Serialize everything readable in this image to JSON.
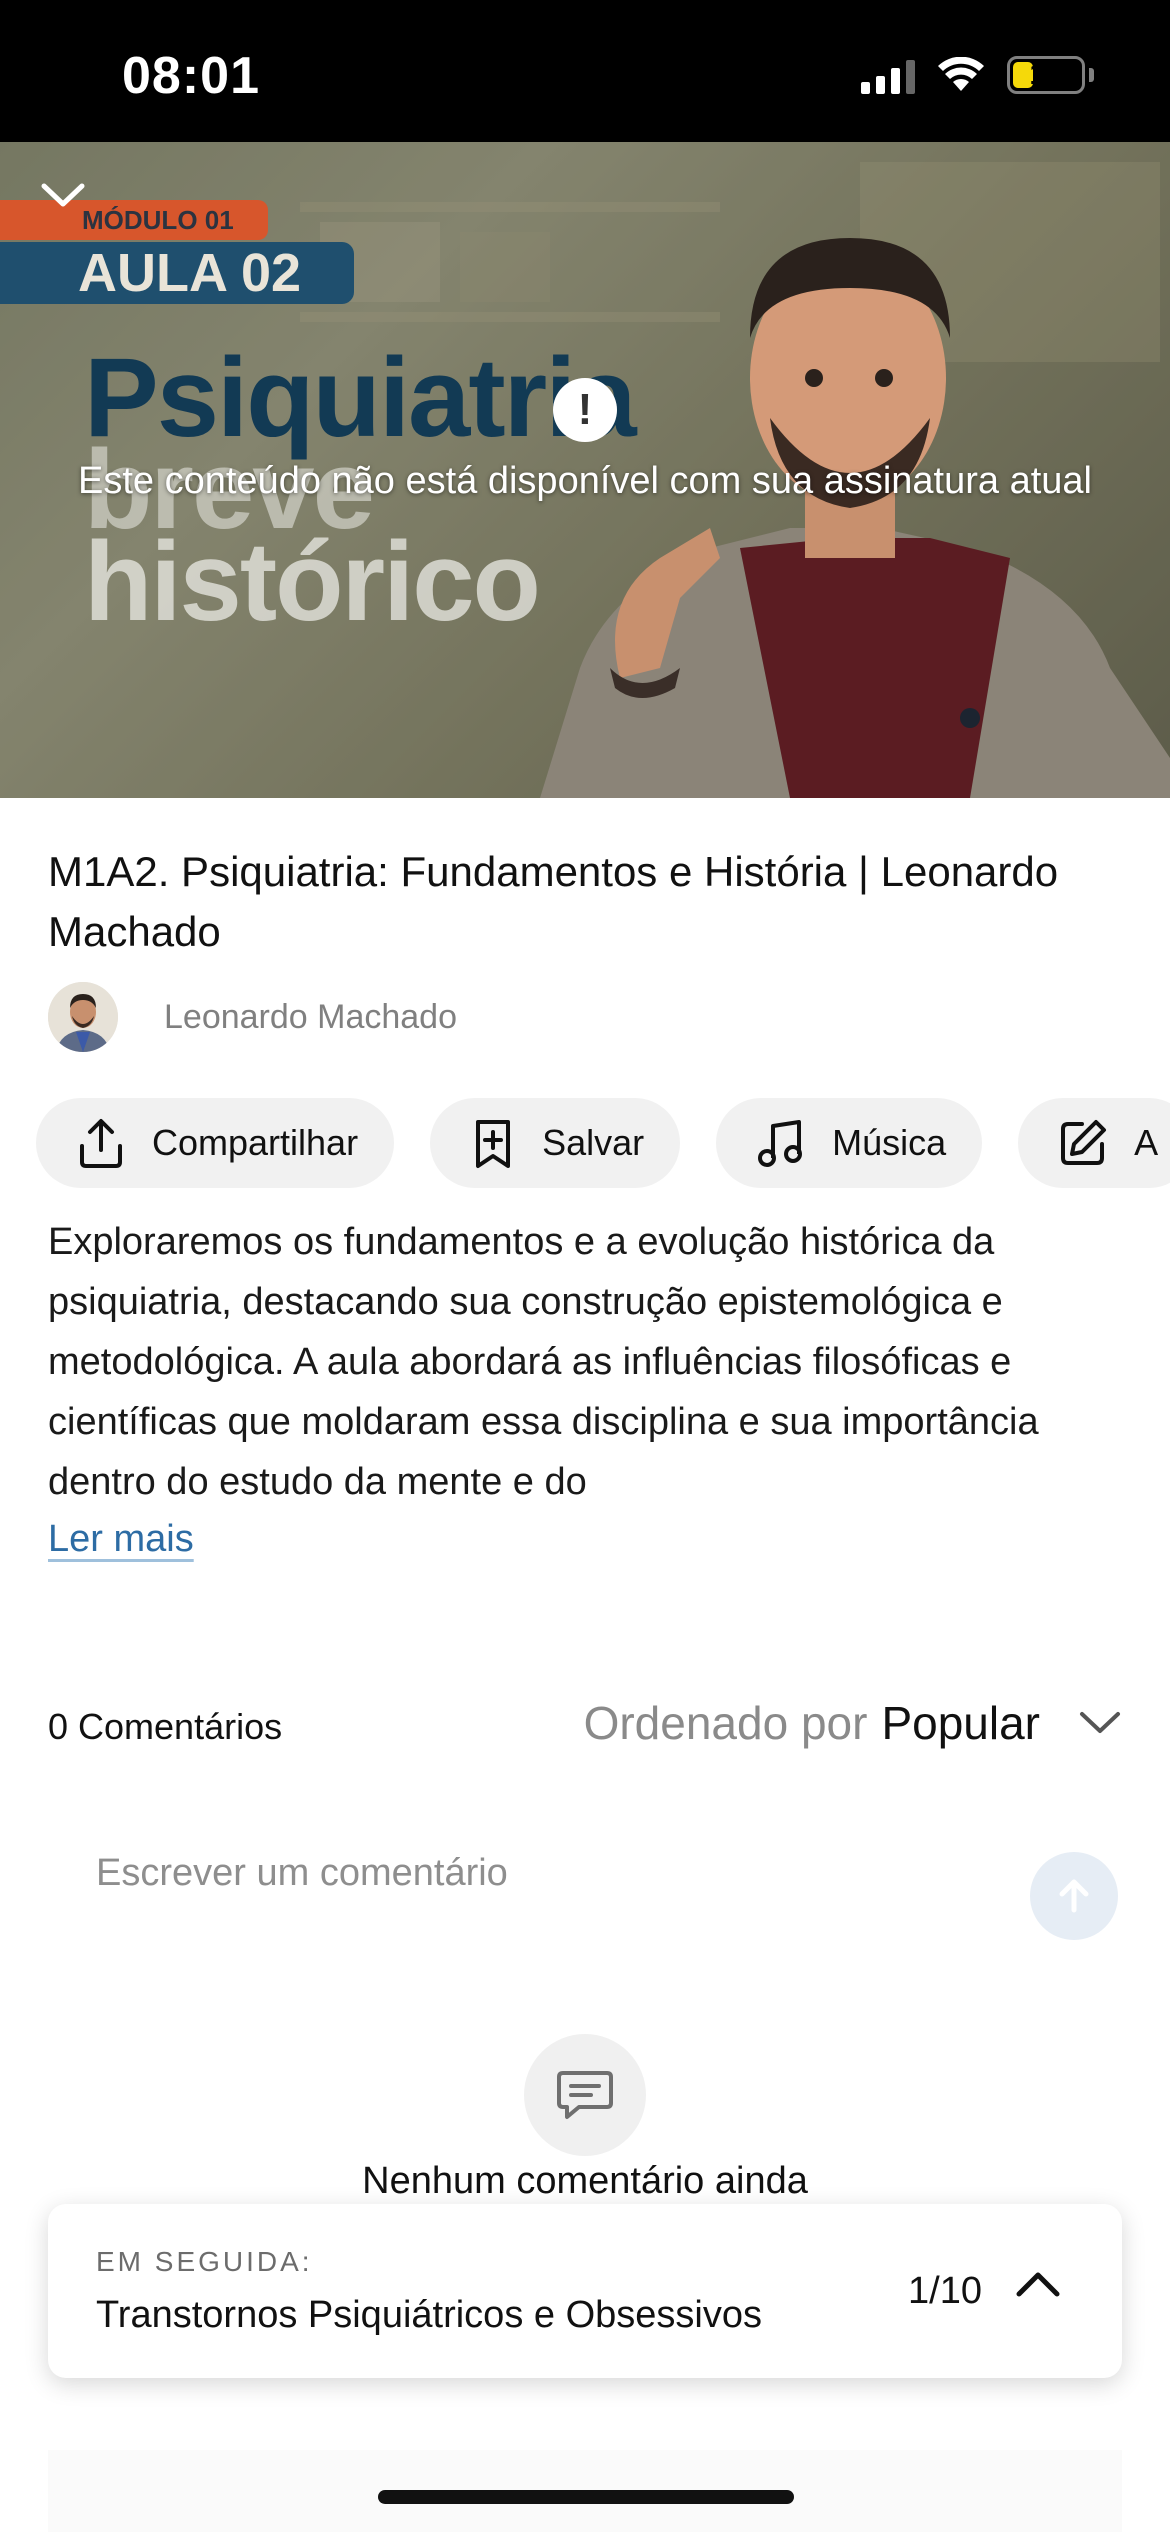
{
  "status_bar": {
    "time": "08:01",
    "battery": "15",
    "icons": [
      "cellular-signal-icon",
      "wifi-icon",
      "battery-icon"
    ]
  },
  "video": {
    "thumbnail_module": "MÓDULO 01",
    "thumbnail_lesson": "AULA 02",
    "thumbnail_title_lines": [
      "Psiquiatria",
      "breve",
      "histórico"
    ],
    "lock_message": "Este conteúdo não está disponível com sua assinatura atual",
    "icons": [
      "chevron-down-icon",
      "warning-icon"
    ]
  },
  "lesson": {
    "title": "M1A2. Psiquiatria: Fundamentos e História | Leonardo Machado",
    "author": "Leonardo Machado",
    "description": "Exploraremos os fundamentos e a evolução histórica da psiquiatria, destacando sua construção epistemológica e metodológica. A aula abordará as influências filosóficas e científicas que moldaram essa disciplina e sua importância dentro do estudo da mente e do",
    "read_more": "Ler mais"
  },
  "actions": [
    {
      "label": "Compartilhar",
      "icon": "share-icon"
    },
    {
      "label": "Salvar",
      "icon": "bookmark-plus-icon"
    },
    {
      "label": "Música",
      "icon": "music-note-icon"
    },
    {
      "label": "A",
      "icon": "edit-icon"
    }
  ],
  "comments": {
    "count_label": "0 Comentários",
    "sort_prefix": "Ordenado por",
    "sort_value": "Popular",
    "input_placeholder": "Escrever um comentário",
    "empty_message": "Nenhum comentário ainda"
  },
  "up_next": {
    "label": "EM SEGUIDA:",
    "title": "Transtornos Psiquiátricos e Obsessivos",
    "position": "1/10"
  },
  "colors": {
    "link": "#2d6ca4",
    "module_tag": "#d7562c",
    "lesson_tag": "#1f4f6e",
    "send_button": "#e6edf5"
  }
}
